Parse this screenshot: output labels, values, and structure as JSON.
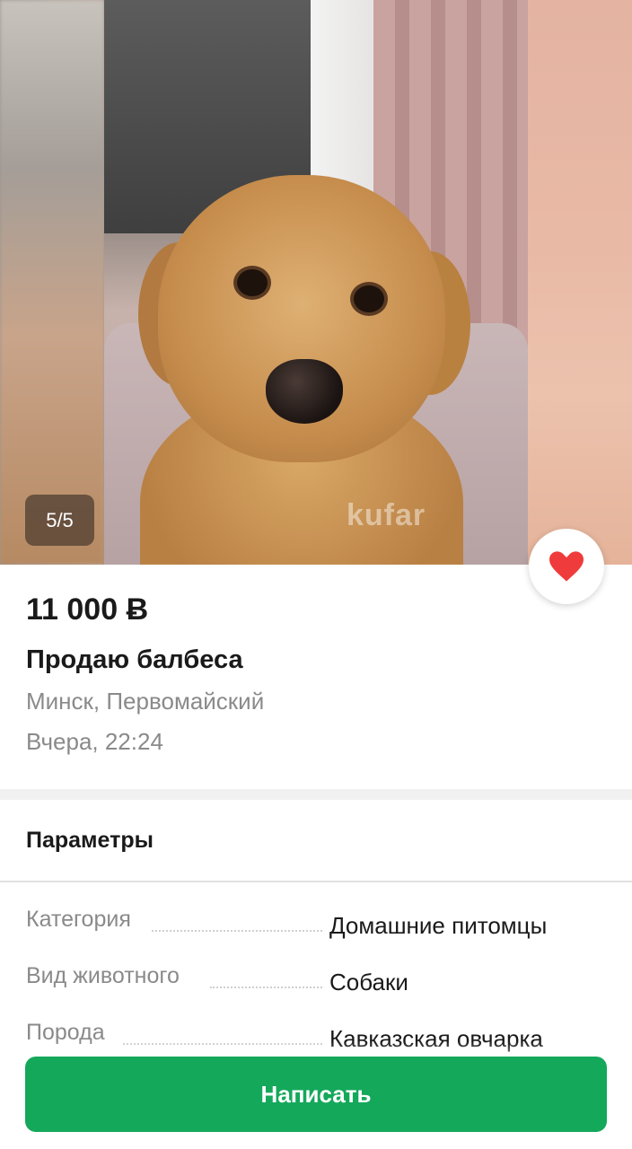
{
  "gallery": {
    "counter": "5/5",
    "watermark": "kufar"
  },
  "favorite": {
    "icon": "heart-icon",
    "active": true,
    "color": "#ef3b3b"
  },
  "listing": {
    "price": "11 000 Ƀ",
    "title": "Продаю балбеса",
    "location": "Минск, Первомайский",
    "posted": "Вчера, 22:24"
  },
  "params": {
    "title": "Параметры",
    "rows": [
      {
        "key": "Категория",
        "value": "Домашние питомцы"
      },
      {
        "key": "Вид животного",
        "value": "Собаки"
      },
      {
        "key": "Порода",
        "value": "Кавказская овчарка"
      }
    ]
  },
  "cta": {
    "label": "Написать",
    "color": "#14a85b"
  }
}
